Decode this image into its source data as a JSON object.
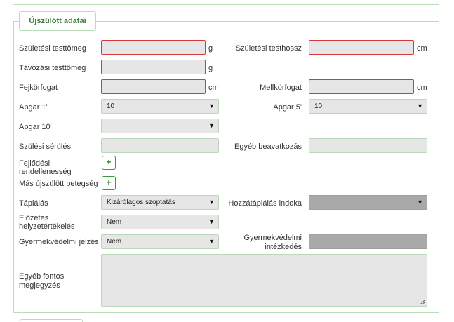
{
  "section": {
    "title": "Újszülött adatai"
  },
  "fields": {
    "birth_weight": {
      "label": "Születési testtömeg",
      "unit": "g"
    },
    "birth_length": {
      "label": "Születési testhossz",
      "unit": "cm"
    },
    "discharge_weight": {
      "label": "Távozási testtömeg",
      "unit": "g"
    },
    "head_circ": {
      "label": "Fejkörfogat",
      "unit": "cm"
    },
    "chest_circ": {
      "label": "Mellkörfogat",
      "unit": "cm"
    },
    "apgar1": {
      "label": "Apgar 1'",
      "value": "10"
    },
    "apgar5": {
      "label": "Apgar 5'",
      "value": "10"
    },
    "apgar10": {
      "label": "Apgar 10'",
      "value": ""
    },
    "birth_injury": {
      "label": "Szülési sérülés"
    },
    "other_intervention": {
      "label": "Egyéb beavatkozás"
    },
    "dev_abnormality": {
      "label_line1": "Fejlődési",
      "label_line2": "rendellenesség",
      "button": "+"
    },
    "other_disease": {
      "label": "Más újszülött betegség",
      "button": "+"
    },
    "feeding": {
      "label": "Táplálás",
      "value": "Kizárólagos szoptatás"
    },
    "supplement_reason": {
      "label": "Hozzátáplálás indoka",
      "value": ""
    },
    "prior_assessment": {
      "label_line1": "Előzetes",
      "label_line2": "helyzetértékelés",
      "value": "Nem"
    },
    "child_protection_signal": {
      "label": "Gyermekvédelmi jelzés",
      "value": "Nem"
    },
    "child_protection_action": {
      "label_line1": "Gyermekvédelmi",
      "label_line2": "intézkedés"
    },
    "notes": {
      "label_line1": "Egyéb fontos",
      "label_line2": "megjegyzés"
    }
  }
}
